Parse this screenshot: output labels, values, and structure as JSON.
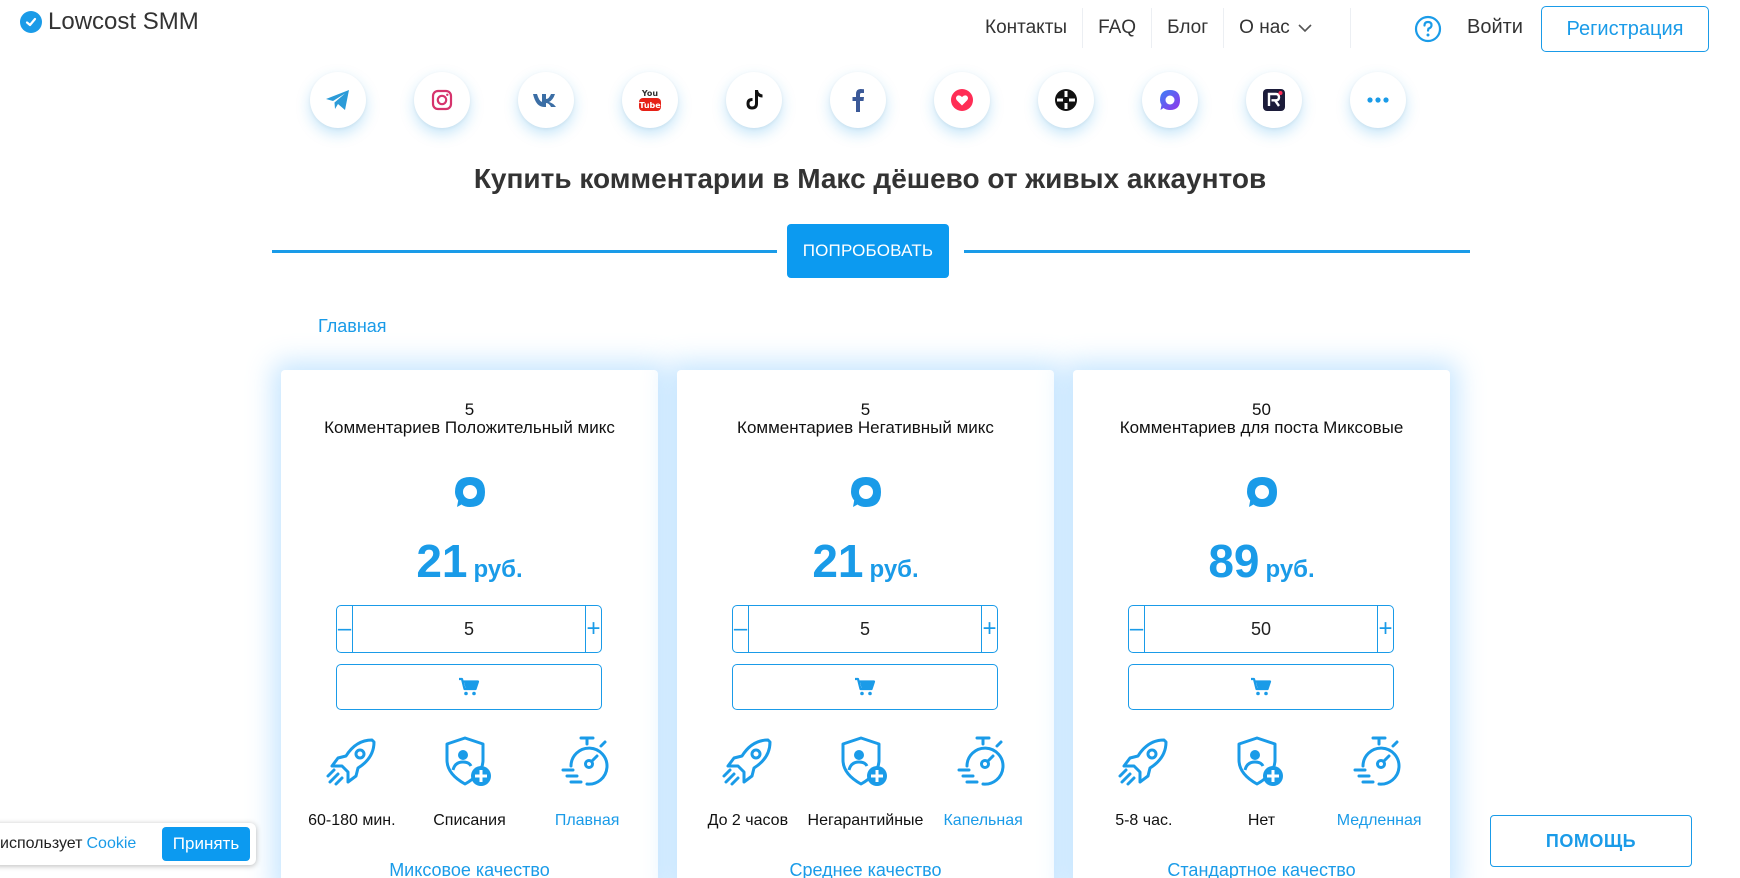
{
  "header": {
    "logo_text": "Lowcost SMM",
    "nav": [
      "Контакты",
      "FAQ",
      "Блог",
      "О нас"
    ],
    "login_label": "Войти",
    "register_label": "Регистрация"
  },
  "socials": [
    {
      "name": "telegram-icon",
      "color": "#2b9bd8"
    },
    {
      "name": "instagram-icon",
      "color": "#d6336c"
    },
    {
      "name": "vk-icon",
      "color": "#3b6ea5"
    },
    {
      "name": "youtube-icon",
      "color": "#e62117"
    },
    {
      "name": "tiktok-icon",
      "color": "#111111"
    },
    {
      "name": "facebook-icon",
      "color": "#3b5998"
    },
    {
      "name": "likee-icon",
      "color": "#ff2d55"
    },
    {
      "name": "rutube-icon",
      "color": "#111111"
    },
    {
      "name": "max-icon",
      "color": "#7c3aed"
    },
    {
      "name": "rutube-r-icon",
      "color": "#1c1c3a"
    },
    {
      "name": "more-icon",
      "color": "#1a9be8"
    }
  ],
  "page": {
    "title": "Купить комментарии в Макс дёшево от живых аккаунтов",
    "try_label": "ПОПРОБОВАТЬ",
    "breadcrumb": "Главная"
  },
  "cards": [
    {
      "qty": "5",
      "name": "Комментариев Положительный микс",
      "price": "21",
      "currency": "руб.",
      "input_value": "5",
      "features": [
        "60-180 мин.",
        "Списания",
        "Плавная"
      ],
      "quality": "Миксовое качество"
    },
    {
      "qty": "5",
      "name": "Комментариев Негативный микс",
      "price": "21",
      "currency": "руб.",
      "input_value": "5",
      "features": [
        "До 2 часов",
        "Негарантийные",
        "Капельная"
      ],
      "quality": "Среднее качество"
    },
    {
      "qty": "50",
      "name": "Комментариев для поста Миксовые",
      "price": "89",
      "currency": "руб.",
      "input_value": "50",
      "features": [
        "5-8 час.",
        "Нет",
        "Медленная"
      ],
      "quality": "Стандартное качество"
    }
  ],
  "stepper": {
    "minus": "–",
    "plus": "+"
  },
  "cookie": {
    "text": "использует",
    "link": "Cookie",
    "accept_label": "Принять"
  },
  "help_label": "ПОМОЩЬ",
  "colors": {
    "accent": "#1a9be8",
    "button": "#0c9af0"
  }
}
